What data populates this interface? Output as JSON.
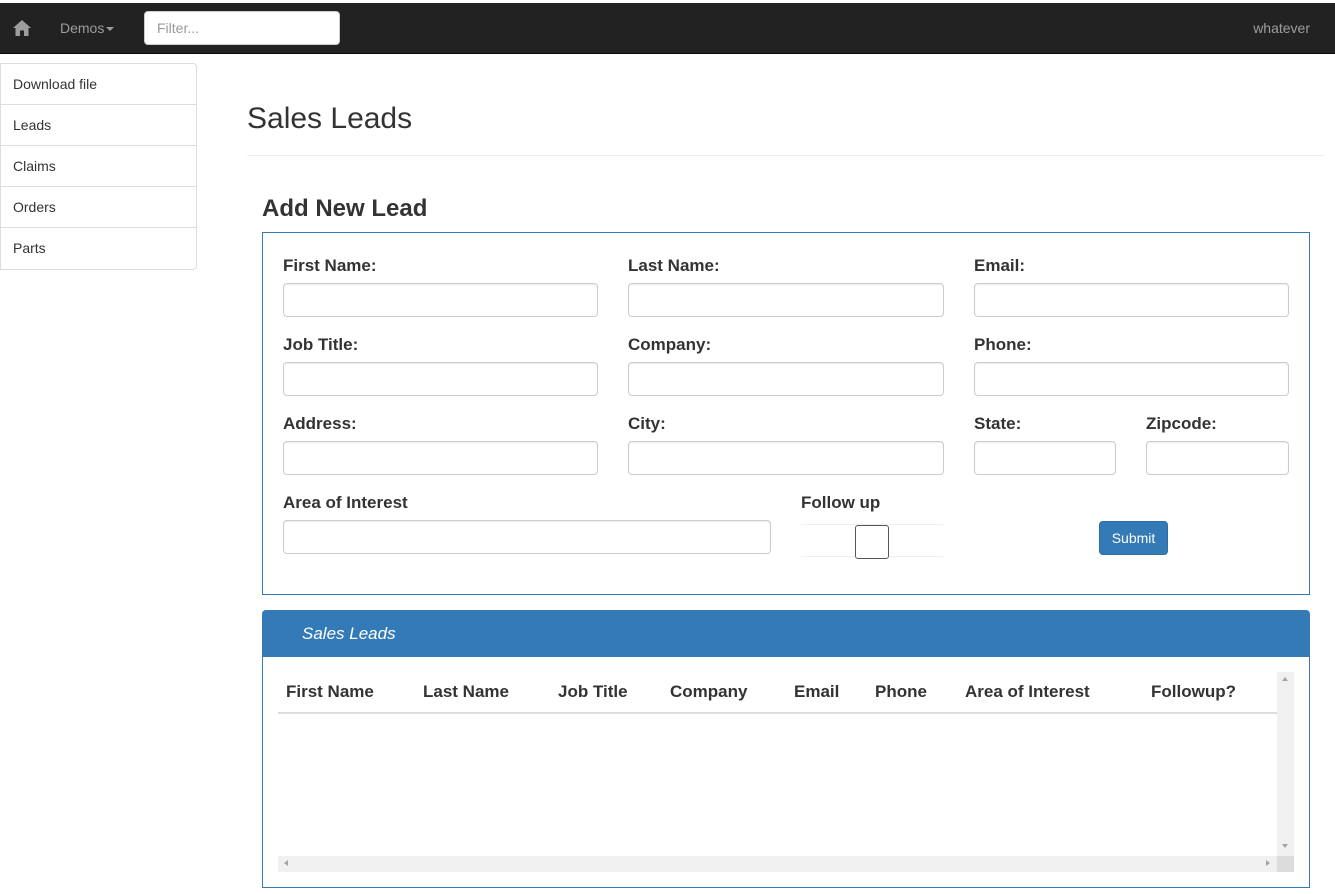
{
  "navbar": {
    "home_icon": "home-icon",
    "demos_label": "Demos",
    "filter_placeholder": "Filter...",
    "user_label": "whatever"
  },
  "sidebar": {
    "items": [
      {
        "label": "Download file"
      },
      {
        "label": "Leads"
      },
      {
        "label": "Claims"
      },
      {
        "label": "Orders"
      },
      {
        "label": "Parts"
      }
    ]
  },
  "page": {
    "title": "Sales Leads",
    "form_title": "Add New Lead"
  },
  "form": {
    "first_name_label": "First Name:",
    "last_name_label": "Last Name:",
    "email_label": "Email:",
    "job_title_label": "Job Title:",
    "company_label": "Company:",
    "phone_label": "Phone:",
    "address_label": "Address:",
    "city_label": "City:",
    "state_label": "State:",
    "zipcode_label": "Zipcode:",
    "area_of_interest_label": "Area of Interest",
    "follow_up_label": "Follow up",
    "follow_up_checked": false,
    "submit_label": "Submit"
  },
  "grid": {
    "heading": "Sales Leads",
    "columns": [
      "First Name",
      "Last Name",
      "Job Title",
      "Company",
      "Email",
      "Phone",
      "Area of Interest",
      "Followup?"
    ],
    "rows": []
  },
  "colors": {
    "navbar_bg": "#222222",
    "primary": "#337ab7",
    "navbar_text": "#9d9d9d"
  }
}
